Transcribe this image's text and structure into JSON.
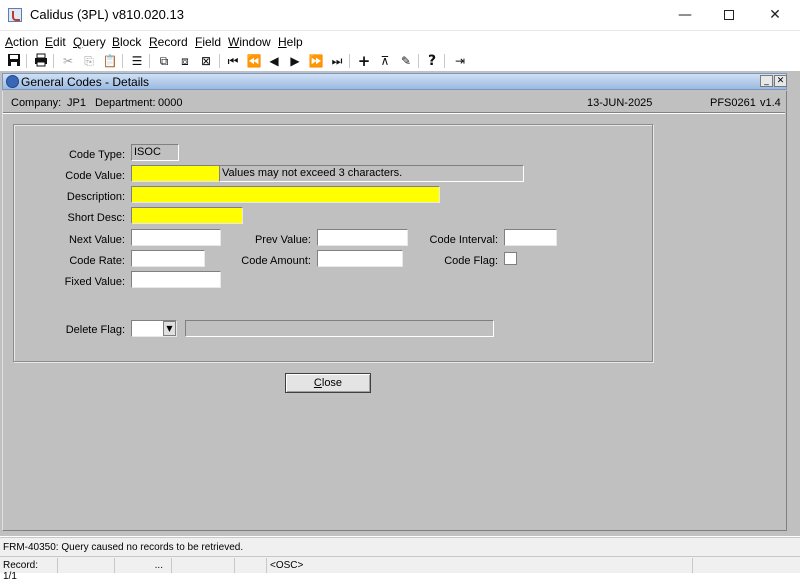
{
  "window": {
    "title": "Calidus (3PL) v810.020.13",
    "minimize_glyph": "—",
    "close_glyph": "✕"
  },
  "menu": [
    "Action",
    "Edit",
    "Query",
    "Block",
    "Record",
    "Field",
    "Window",
    "Help"
  ],
  "toolbar": {
    "icons": [
      "save-icon",
      "print-icon",
      "cut-icon",
      "copy-icon",
      "paste-icon",
      "list-icon",
      "duplicate-record-icon",
      "duplicate-field-icon",
      "clear-record-icon",
      "first-record-icon",
      "previous-block-icon",
      "previous-record-icon",
      "next-record-icon",
      "next-block-icon",
      "last-record-icon",
      "insert-record-icon",
      "delete-record-icon",
      "clear-field-icon",
      "help-icon",
      "exit-icon"
    ]
  },
  "form": {
    "title": "General Codes - Details",
    "company_label": "Company:",
    "company": "JP1",
    "department_label": "Department:",
    "department": "0000",
    "date": "13-JUN-2025",
    "form_id": "PFS0261",
    "version": "v1.4"
  },
  "fields": {
    "code_type": {
      "label": "Code Type:",
      "value": "ISOC"
    },
    "code_value": {
      "label": "Code Value:",
      "value": "",
      "hint": "Values may not exceed 3 characters."
    },
    "description": {
      "label": "Description:",
      "value": ""
    },
    "short_desc": {
      "label": "Short Desc:",
      "value": ""
    },
    "next_value": {
      "label": "Next Value:",
      "value": ""
    },
    "prev_value": {
      "label": "Prev Value:",
      "value": ""
    },
    "code_interval": {
      "label": "Code Interval:",
      "value": ""
    },
    "code_rate": {
      "label": "Code Rate:",
      "value": ""
    },
    "code_amount": {
      "label": "Code Amount:",
      "value": ""
    },
    "code_flag": {
      "label": "Code Flag:",
      "checked": false
    },
    "fixed_value": {
      "label": "Fixed Value:",
      "value": ""
    },
    "delete_flag": {
      "label": "Delete Flag:",
      "value": "",
      "description": ""
    }
  },
  "buttons": {
    "close": "Close"
  },
  "status": {
    "message": "FRM-40350: Query caused no records to be retrieved.",
    "record": "Record: 1/1",
    "ellipsis": "...",
    "osc": "<OSC>"
  },
  "colors": {
    "required_field": "#ffff00",
    "canvas": "#c0c0c0"
  }
}
